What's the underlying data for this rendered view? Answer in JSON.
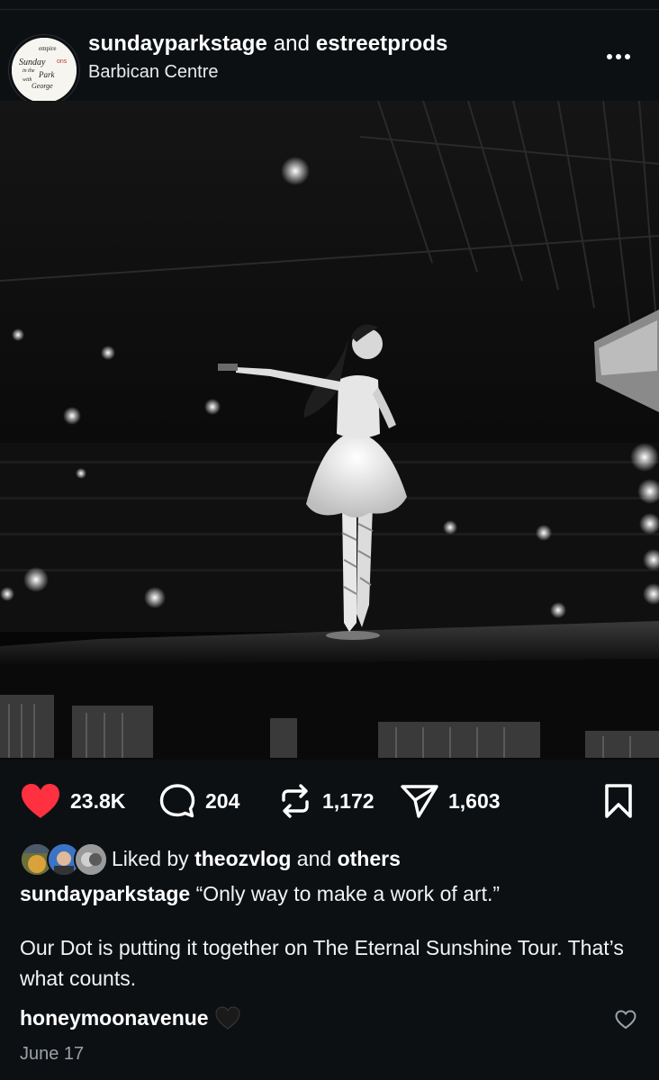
{
  "post": {
    "account_primary": "sundayparkstage",
    "account_joiner": "and",
    "account_secondary": "estreetprods",
    "location": "Barbican Centre",
    "avatar_text": [
      "empire",
      "Sunday",
      "in the",
      "Park",
      "with",
      "George",
      "ons"
    ]
  },
  "actions": {
    "likes": "23.8K",
    "comments": "204",
    "reposts": "1,172",
    "shares": "1,603",
    "like_color": "#ff3040"
  },
  "liked_by": {
    "prefix": "Liked by",
    "user": "theozvlog",
    "joiner": "and",
    "others": "others"
  },
  "caption": {
    "user": "sundayparkstage",
    "line1": "“Only way to make a work of art.”",
    "body": "Our Dot is putting it together on The Eternal Sunshine Tour. That’s what counts."
  },
  "comment": {
    "user": "honeymoonavenue",
    "emoji": "black-heart-icon"
  },
  "date": "June 17"
}
